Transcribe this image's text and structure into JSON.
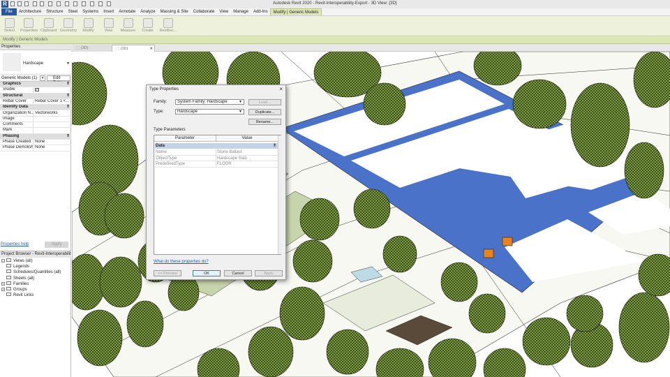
{
  "window": {
    "title": "Autodesk Revit 2020 - Revit-Interoperability-Export - 3D View: {3D}",
    "app_logo": "R"
  },
  "ribbon": {
    "tabs": [
      "File",
      "Architecture",
      "Structure",
      "Steel",
      "Systems",
      "Insert",
      "Annotate",
      "Analyze",
      "Massing & Site",
      "Collaborate",
      "View",
      "Manage",
      "Add-Ins",
      "Modify | Generic Models"
    ],
    "active_tab": "Modify | Generic Models",
    "buttons": [
      "Select",
      "Properties",
      "Clipboard",
      "Geometry",
      "Modify",
      "View",
      "Measure",
      "Create",
      "Reinforc..."
    ],
    "context_label": "Modify | Generic Models"
  },
  "properties": {
    "title": "Properties",
    "type_name": "Hardscape",
    "filter": "Generic Models (1)",
    "edit_type": "Edit Type",
    "rows": [
      {
        "k": "Graphics",
        "v": "",
        "group": true
      },
      {
        "k": "Visible",
        "v": "",
        "check": true
      },
      {
        "k": "Structural",
        "v": "",
        "group": true
      },
      {
        "k": "Rebar Cover",
        "v": "Rebar Cover 1 <..."
      },
      {
        "k": "Identity Data",
        "v": "",
        "group": true
      },
      {
        "k": "Organization N...",
        "v": "Vectorworks"
      },
      {
        "k": "Image",
        "v": ""
      },
      {
        "k": "Comments",
        "v": ""
      },
      {
        "k": "Mark",
        "v": ""
      },
      {
        "k": "Phasing",
        "v": "",
        "group": true
      },
      {
        "k": "Phase Created",
        "v": "None"
      },
      {
        "k": "Phase Demolish...",
        "v": "None"
      }
    ],
    "help_link": "Properties help",
    "apply": "Apply"
  },
  "browser": {
    "title": "Project Browser - Revit-Interoperabilit...",
    "items": [
      {
        "label": "Views (all)",
        "toggle": "–"
      },
      {
        "label": "Legends",
        "toggle": ""
      },
      {
        "label": "Schedules/Quantities (all)",
        "toggle": ""
      },
      {
        "label": "Sheets (all)",
        "toggle": ""
      },
      {
        "label": "Families",
        "toggle": "+"
      },
      {
        "label": "Groups",
        "toggle": "+"
      },
      {
        "label": "Revit Links",
        "toggle": ""
      }
    ]
  },
  "view_tabs": [
    "{3D}",
    "{3D}"
  ],
  "dialog": {
    "title": "Type Properties",
    "family_label": "Family:",
    "family_value": "System Family: Hardscape",
    "type_label": "Type:",
    "type_value": "Hardscape",
    "load": "Load...",
    "duplicate": "Duplicate...",
    "rename": "Rename...",
    "type_params_label": "Type Parameters",
    "col_param": "Parameter",
    "col_value": "Value",
    "group": "Data",
    "rows": [
      {
        "k": "Name",
        "v": "Stone Ballast"
      },
      {
        "k": "ObjectType",
        "v": "Hardscape Slab"
      },
      {
        "k": "PredefinedType",
        "v": "FLOOR"
      }
    ],
    "what_link": "What do these properties do?",
    "preview": "<< Preview",
    "ok": "OK",
    "cancel": "Cancel",
    "apply": "Apply"
  },
  "colors": {
    "accent": "#2b5797",
    "building": "#4a72c8",
    "tree": "#8fb04a",
    "ground": "#c8d4ac"
  }
}
